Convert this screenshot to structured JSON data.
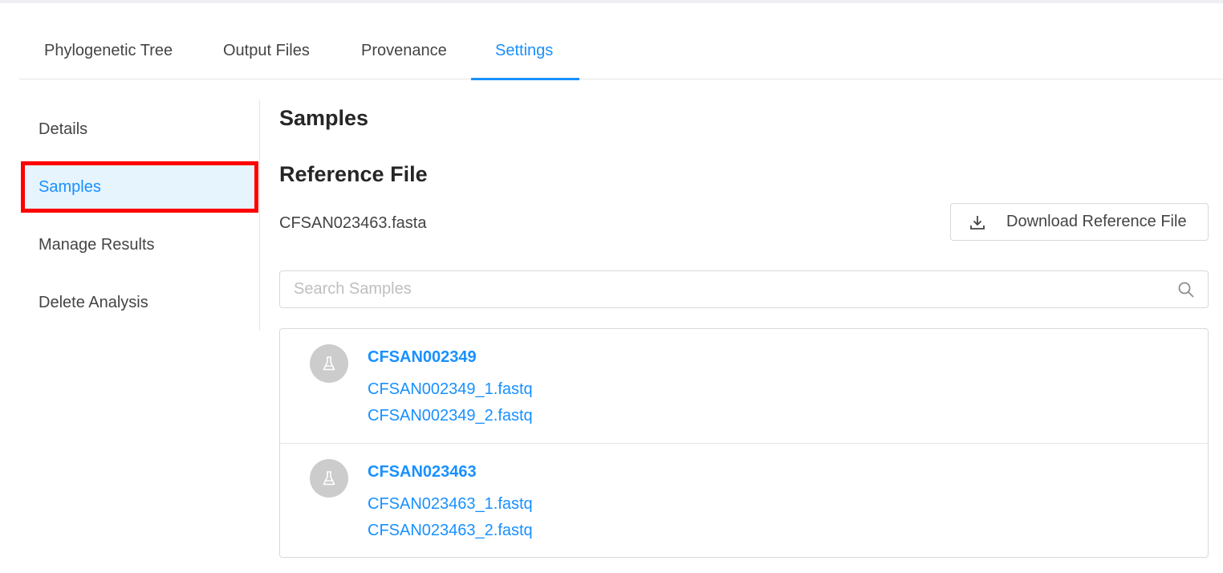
{
  "tabs": [
    {
      "label": "Phylogenetic Tree"
    },
    {
      "label": "Output Files"
    },
    {
      "label": "Provenance"
    },
    {
      "label": "Settings",
      "active": true
    }
  ],
  "sidebar": {
    "items": [
      {
        "label": "Details"
      },
      {
        "label": "Samples",
        "selected": true
      },
      {
        "label": "Manage Results"
      },
      {
        "label": "Delete Analysis"
      }
    ]
  },
  "main": {
    "title": "Samples",
    "reference": {
      "heading": "Reference File",
      "filename": "CFSAN023463.fasta",
      "download_label": "Download Reference File",
      "download_icon": "download-icon"
    },
    "search": {
      "placeholder": "Search Samples",
      "icon": "search-icon"
    },
    "samples": [
      {
        "name": "CFSAN002349",
        "icon": "flask-icon",
        "files": [
          "CFSAN002349_1.fastq",
          "CFSAN002349_2.fastq"
        ]
      },
      {
        "name": "CFSAN023463",
        "icon": "flask-icon",
        "files": [
          "CFSAN023463_1.fastq",
          "CFSAN023463_2.fastq"
        ]
      }
    ]
  },
  "colors": {
    "accent": "#1890ff",
    "highlight_border": "#ff0000",
    "selected_bg": "#e6f4fd",
    "avatar_bg": "#cccccc"
  }
}
